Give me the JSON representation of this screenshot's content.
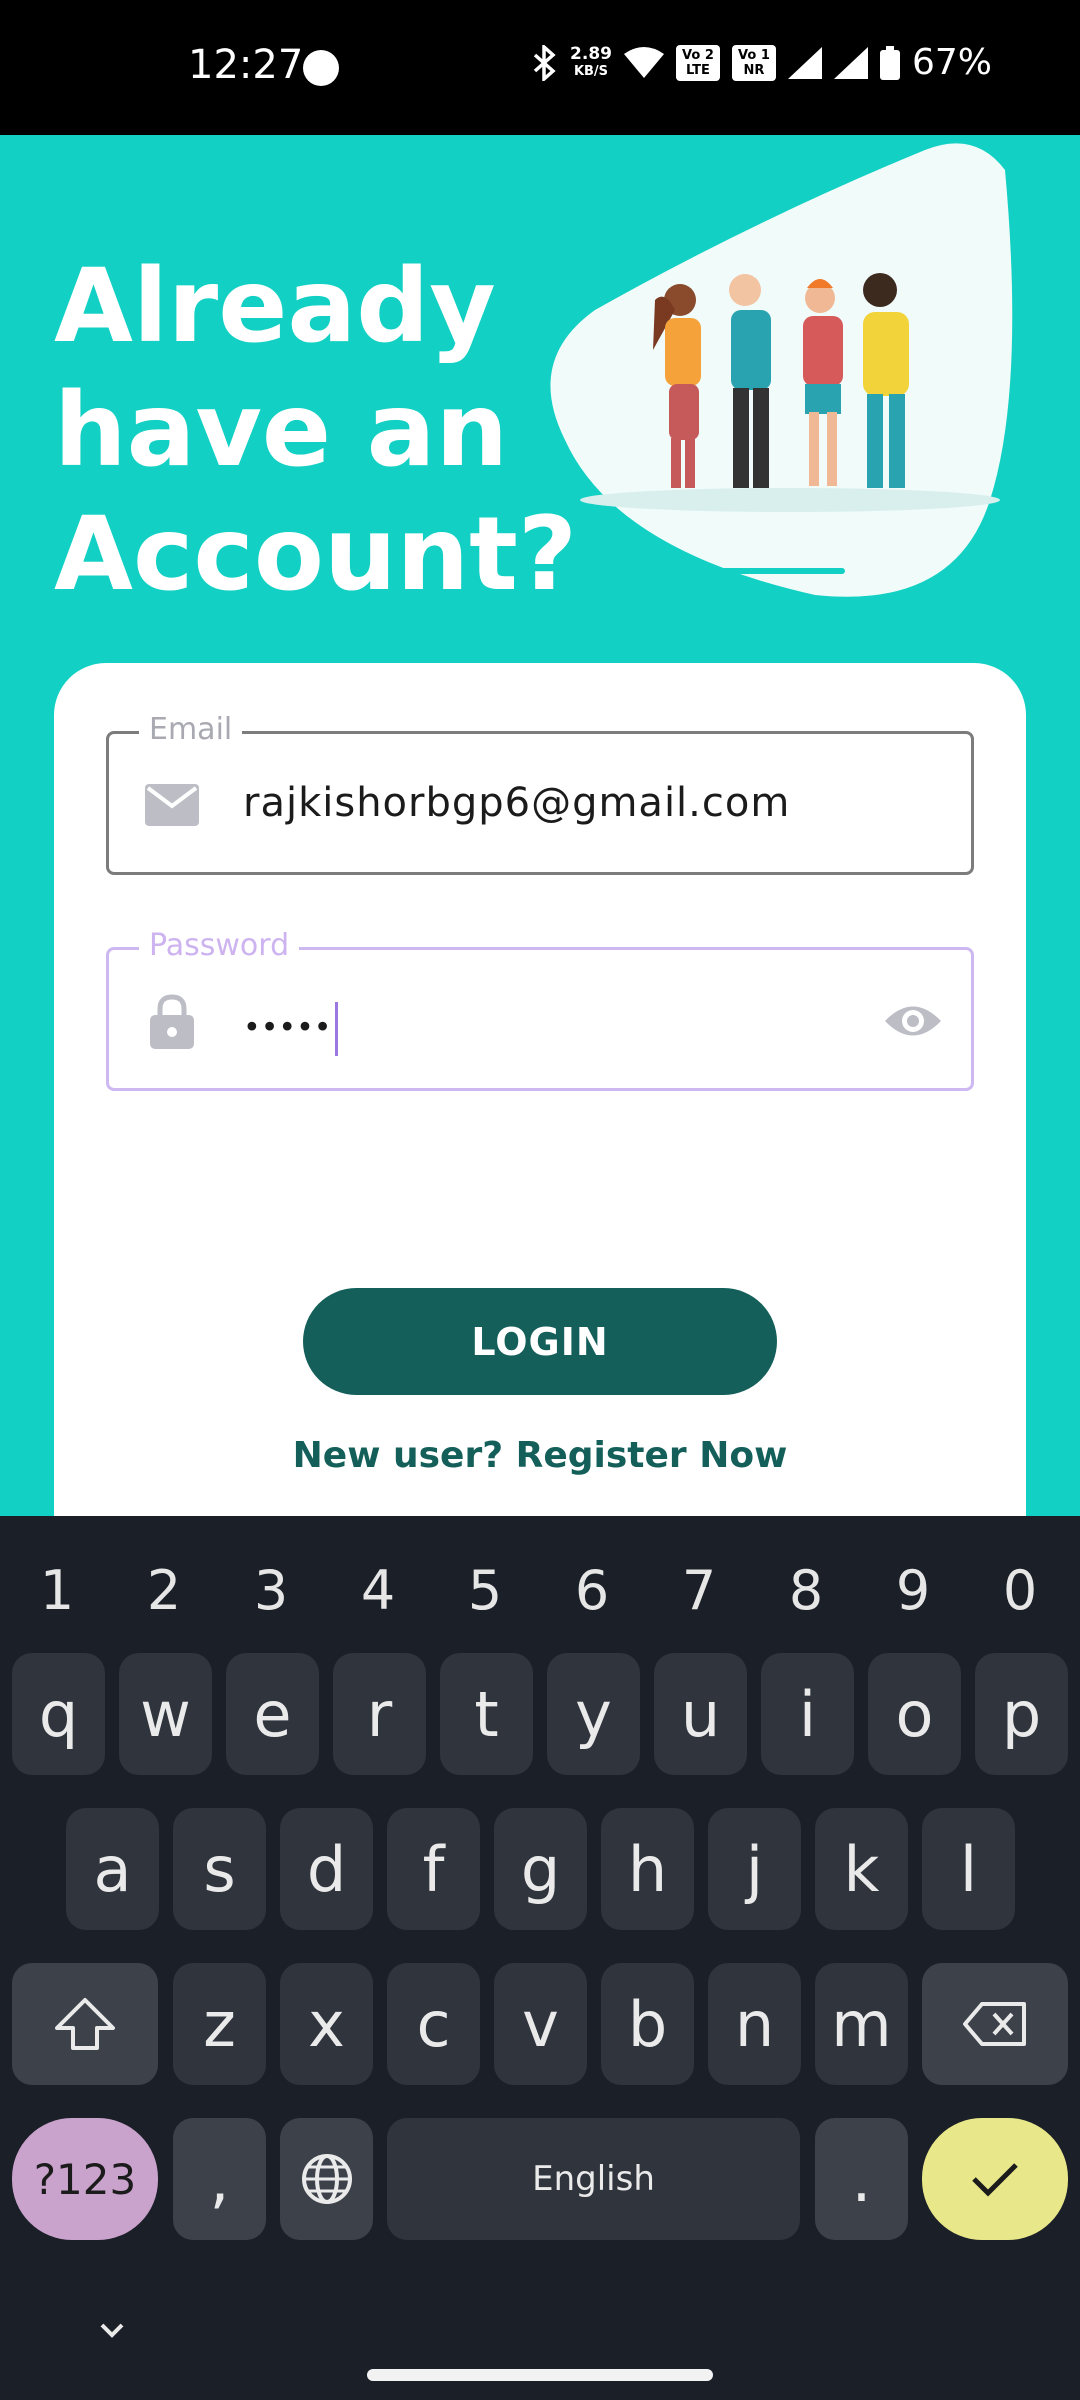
{
  "status_bar": {
    "time": "12:27",
    "net_speed_value": "2.89",
    "net_speed_unit": "KB/S",
    "sim1_top": "Vo",
    "sim1_bottom": "LTE",
    "sim1_num": "2",
    "sim2_top": "Vo",
    "sim2_bottom": "NR",
    "sim2_num": "1",
    "battery_percent": "67%",
    "icons": [
      "bluetooth-icon",
      "wifi-icon",
      "signal-icon",
      "signal-icon",
      "battery-icon"
    ]
  },
  "header": {
    "title": "Already have an Account?"
  },
  "form": {
    "email_label": "Email",
    "email_value": "rajkishorbgp6@gmail.com",
    "password_label": "Password",
    "password_value": "•••••",
    "login_label": "LOGIN",
    "register_label": "New user? Register Now"
  },
  "keyboard": {
    "numbers": [
      "1",
      "2",
      "3",
      "4",
      "5",
      "6",
      "7",
      "8",
      "9",
      "0"
    ],
    "row1": [
      "q",
      "w",
      "e",
      "r",
      "t",
      "y",
      "u",
      "i",
      "o",
      "p"
    ],
    "row2": [
      "a",
      "s",
      "d",
      "f",
      "g",
      "h",
      "j",
      "k",
      "l"
    ],
    "row3": [
      "z",
      "x",
      "c",
      "v",
      "b",
      "n",
      "m"
    ],
    "symbols_label": "?123",
    "comma_label": ",",
    "space_label": "English",
    "period_label": "."
  },
  "colors": {
    "background": "#12d0c3",
    "primary": "#145f5a",
    "focus_outline": "#cdb8f2",
    "keyboard_bg": "#1b1f27",
    "enter_key": "#e8e88a",
    "symbols_key": "#c9a3cc"
  }
}
